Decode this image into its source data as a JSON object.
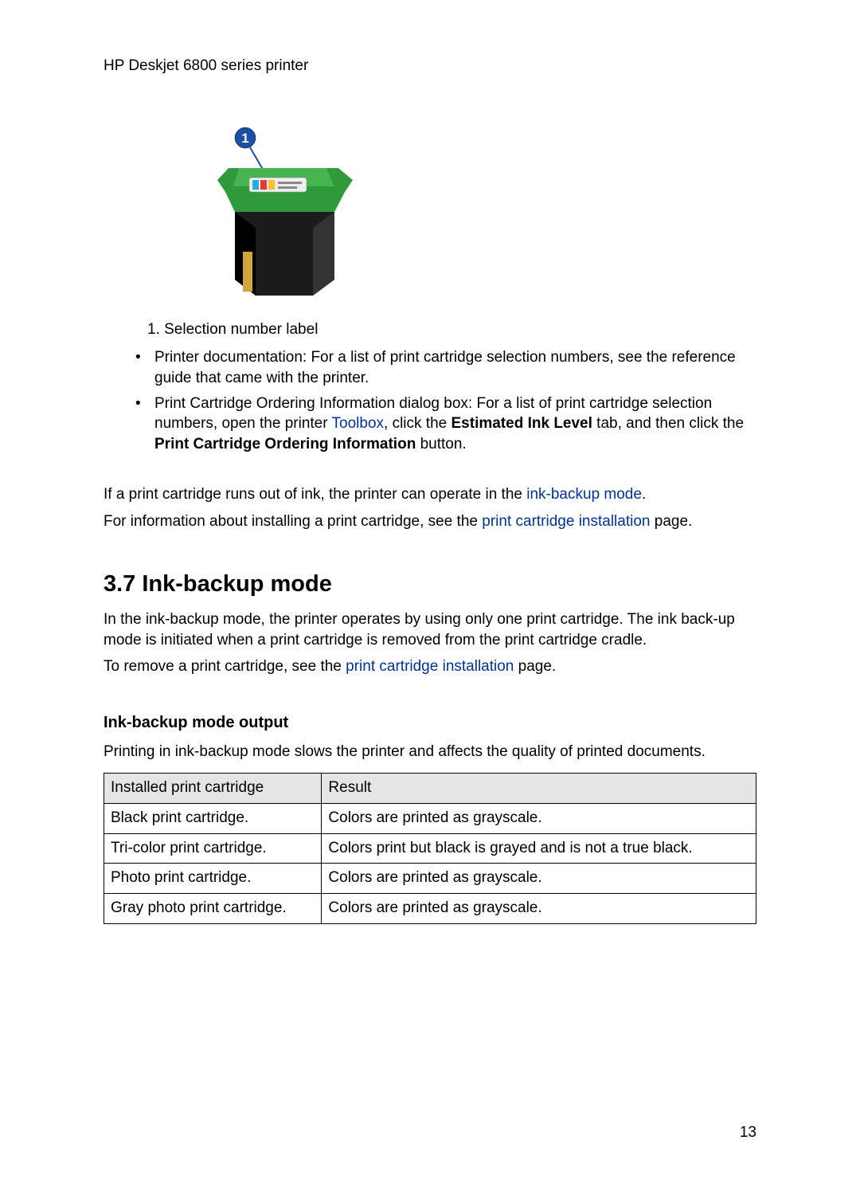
{
  "header": "HP Deskjet 6800 series printer",
  "figure": {
    "callout_number": "1",
    "caption": "1. Selection number label"
  },
  "bullets": [
    {
      "text_before": "Printer documentation: For a list of print cartridge selection numbers, see the reference guide that came with the printer."
    },
    {
      "text_parts": {
        "p1": "Print Cartridge Ordering Information dialog box: For a list of print cartridge selection numbers, open the printer ",
        "link1": "Toolbox",
        "p2": ", click the ",
        "bold1": "Estimated Ink Level",
        "p3": " tab, and then click the ",
        "bold2": "Print Cartridge Ordering Information",
        "p4": " button."
      }
    }
  ],
  "body1": {
    "p1": "If a print cartridge runs out of ink, the printer can operate in the ",
    "link1": "ink-backup mode",
    "p2": "."
  },
  "body2": {
    "p1": "For information about installing a print cartridge, see the ",
    "link1": "print cartridge installation",
    "p2": " page."
  },
  "section_title": "3.7  Ink-backup mode",
  "section_intro": "In the ink-backup mode, the printer operates by using only one print cartridge. The ink back-up mode is initiated when a print cartridge is removed from the print cartridge cradle.",
  "section_remove": {
    "p1": "To remove a print cartridge, see the ",
    "link1": "print cartridge installation",
    "p2": " page."
  },
  "subhead": "Ink-backup mode output",
  "subhead_intro": "Printing in ink-backup mode slows the printer and affects the quality of printed documents.",
  "table": {
    "headers": [
      "Installed print cartridge",
      "Result"
    ],
    "rows": [
      [
        "Black print cartridge.",
        "Colors are printed as grayscale."
      ],
      [
        "Tri-color print cartridge.",
        "Colors print but black is grayed and is not a true black."
      ],
      [
        "Photo print cartridge.",
        "Colors are printed as grayscale."
      ],
      [
        "Gray photo print cartridge.",
        "Colors are printed as grayscale."
      ]
    ]
  },
  "page_number": "13"
}
